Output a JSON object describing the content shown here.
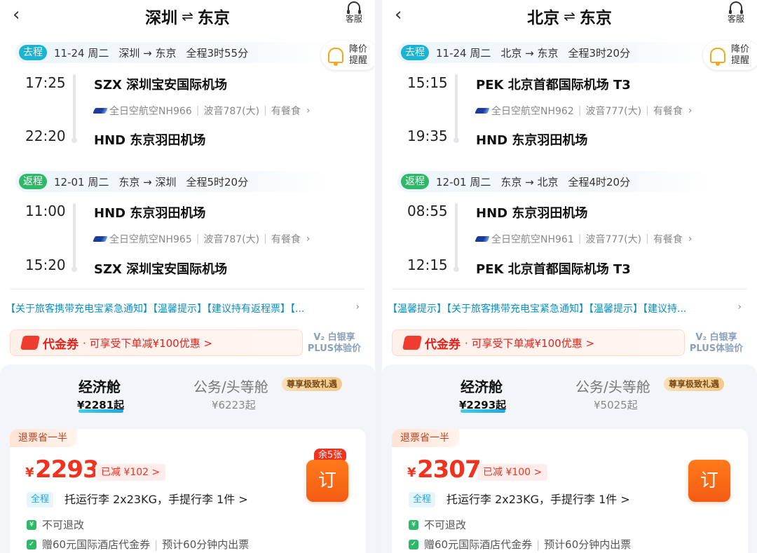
{
  "panels": [
    {
      "header": {
        "back_icon": "‹",
        "from": "深圳",
        "to": "东京",
        "service": "客服"
      },
      "price_alert": {
        "label": "降价提醒"
      },
      "outbound": {
        "tag": "去程",
        "date": "11-24 周二",
        "route": "深圳 → 东京",
        "duration": "全程3时55分",
        "dep_time": "17:25",
        "dep_airport": "SZX 深圳宝安国际机场",
        "airline": "全日空航空NH966",
        "aircraft": "波音787(大)",
        "meal": "有餐食",
        "arr_time": "22:20",
        "arr_airport": "HND 东京羽田机场"
      },
      "return": {
        "tag": "返程",
        "date": "12-01 周二",
        "route": "东京 → 深圳",
        "duration": "全程5时20分",
        "dep_time": "11:00",
        "dep_airport": "HND 东京羽田机场",
        "airline": "全日空航空NH965",
        "aircraft": "波音787(大)",
        "meal": "有餐食",
        "arr_time": "15:20",
        "arr_airport": "SZX 深圳宝安国际机场"
      },
      "notice": "【关于旅客携带充电宝紧急通知】【温馨提示】【建议持有返程票】【...",
      "voucher": {
        "title": "代金券",
        "desc": "· 可享受下单减¥100优惠 >"
      },
      "plus": {
        "line1": "V₂ 白银享",
        "line2": "PLUS体验价"
      },
      "cabins": {
        "economy": {
          "label": "经济舱",
          "price": "¥2281起"
        },
        "business": {
          "label": "公务/头等舱",
          "price": "¥6223起",
          "badge": "尊享极致礼遇"
        }
      },
      "offer": {
        "badge": "退票省一半",
        "currency": "¥",
        "price": "2293",
        "discount": "已减 ¥102 >",
        "remaining": "余5张",
        "book": "订",
        "scope": "全程",
        "baggage": "托运行李 2x23KG，手提行李 1件 >",
        "refund_icon": "¥",
        "refund": "不可退改",
        "hotel": "赠60元国际酒店代金券",
        "ticketing": "预计60分钟内出票"
      }
    },
    {
      "header": {
        "back_icon": "‹",
        "from": "北京",
        "to": "东京",
        "service": "客服"
      },
      "price_alert": {
        "label": "降价提醒"
      },
      "outbound": {
        "tag": "去程",
        "date": "11-24 周二",
        "route": "北京 → 东京",
        "duration": "全程3时20分",
        "dep_time": "15:15",
        "dep_airport": "PEK 北京首都国际机场 T3",
        "airline": "全日空航空NH962",
        "aircraft": "波音777(大)",
        "meal": "有餐食",
        "arr_time": "19:35",
        "arr_airport": "HND 东京羽田机场"
      },
      "return": {
        "tag": "返程",
        "date": "12-01 周二",
        "route": "东京 → 北京",
        "duration": "全程4时20分",
        "dep_time": "08:55",
        "dep_airport": "HND 东京羽田机场",
        "airline": "全日空航空NH961",
        "aircraft": "波音777(大)",
        "meal": "有餐食",
        "arr_time": "12:15",
        "arr_airport": "PEK 北京首都国际机场 T3"
      },
      "notice": "【温馨提示】【关于旅客携带充电宝紧急通知】【温馨提示】【建议持...",
      "voucher": {
        "title": "代金券",
        "desc": "· 可享受下单减¥100优惠 >"
      },
      "plus": {
        "line1": "V₂ 白银享",
        "line2": "PLUS体验价"
      },
      "cabins": {
        "economy": {
          "label": "经济舱",
          "price": "¥2293起"
        },
        "business": {
          "label": "公务/头等舱",
          "price": "¥5025起",
          "badge": "尊享极致礼遇"
        }
      },
      "offer": {
        "badge": "退票省一半",
        "currency": "¥",
        "price": "2307",
        "discount": "已减 ¥100 >",
        "remaining": "",
        "book": "订",
        "scope": "全程",
        "baggage": "托运行李 2x23KG，手提行李 1件 >",
        "refund_icon": "¥",
        "refund": "不可退改",
        "hotel": "赠60元国际酒店代金券",
        "ticketing": "预计60分钟内出票"
      }
    }
  ]
}
